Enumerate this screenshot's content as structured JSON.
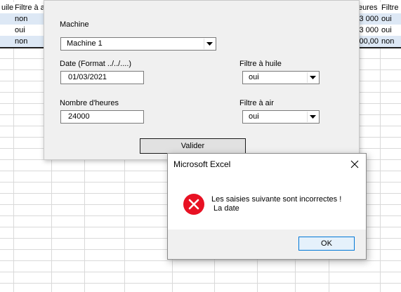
{
  "sheet": {
    "header_cells": [
      "uile",
      "Filtre à a",
      "eures",
      "Filtre"
    ],
    "rows": [
      {
        "filter": "non",
        "hours": "3 000",
        "oil": "oui"
      },
      {
        "filter": "oui",
        "hours": "3 000",
        "oil": "oui"
      },
      {
        "filter": "non",
        "hours": "00,00",
        "oil": "non"
      }
    ]
  },
  "form": {
    "machine_label": "Machine",
    "machine_value": "Machine 1",
    "date_label": "Date (Format ../../....)",
    "date_value": "01/03/2021",
    "oil_filter_label": "Filtre à huile",
    "oil_filter_value": "oui",
    "hours_label": "Nombre d'heures",
    "hours_value": "24000",
    "air_filter_label": "Filtre à air",
    "air_filter_value": "oui",
    "submit_label": "Valider"
  },
  "msgbox": {
    "title": "Microsoft Excel",
    "message": "Les saisies suivante sont incorrectes !\n La date",
    "ok_label": "OK",
    "icon": "error-icon",
    "error_color": "#e81123"
  }
}
